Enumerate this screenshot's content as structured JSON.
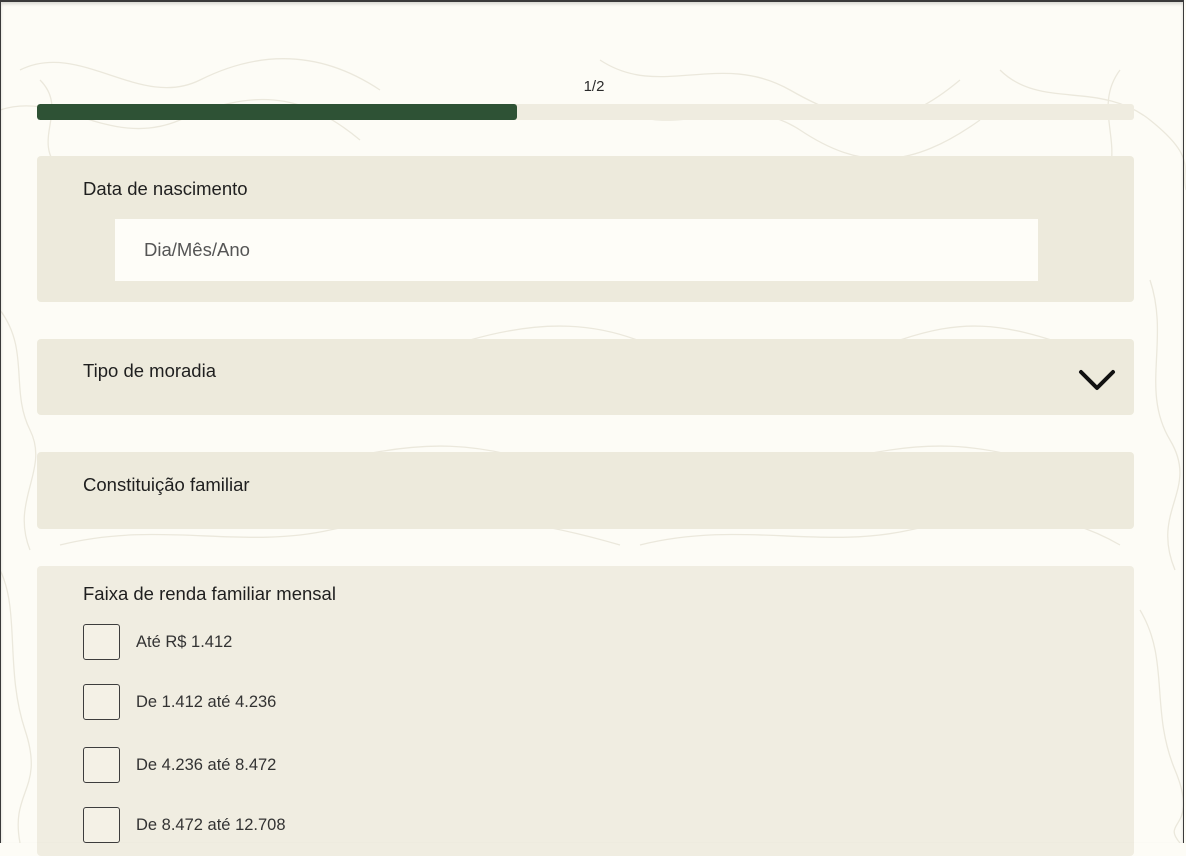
{
  "progress": {
    "label": "1/2",
    "fraction": 0.4375
  },
  "colors": {
    "background": "#fdfcf6",
    "card": "#edeadc",
    "accent": "#2e5235",
    "track": "#efece0",
    "input_bg": "#fefdf8"
  },
  "birth_date": {
    "label": "Data de nascimento",
    "placeholder": "Dia/Mês/Ano",
    "value": ""
  },
  "housing": {
    "label": "Tipo de moradia",
    "icon": "chevron-down-icon"
  },
  "family": {
    "label": "Constituição familiar"
  },
  "income": {
    "label": "Faixa de renda familiar mensal",
    "options": [
      {
        "label": "Até R$ 1.412",
        "checked": false
      },
      {
        "label": "De 1.412 até 4.236",
        "checked": false
      },
      {
        "label": "De 4.236 até 8.472",
        "checked": false
      },
      {
        "label": "De 8.472 até 12.708",
        "checked": false
      }
    ]
  }
}
